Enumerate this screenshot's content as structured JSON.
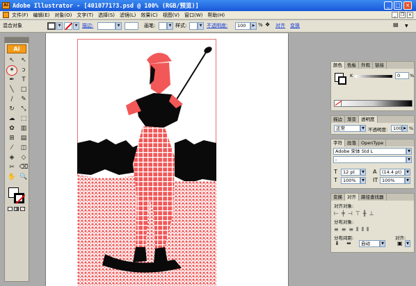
{
  "title_bar": {
    "title": "Adobe Illustrator - [4010771?3.psd @ 100% (RGB/预览)]",
    "app_icon": "Ai",
    "minimize": "_",
    "maximize": "□",
    "close": "×"
  },
  "menu_bar": {
    "items": [
      "文件(F)",
      "编辑(E)",
      "对象(O)",
      "文字(T)",
      "选择(S)",
      "滤镜(L)",
      "效果(C)",
      "视图(V)",
      "窗口(W)",
      "帮助(H)"
    ]
  },
  "control_bar": {
    "selection_label": "混合对象",
    "stroke_label": "描边:",
    "brush_label": "画笔:",
    "style_label": "样式:",
    "opacity_label": "不透明度:",
    "opacity_value": "100",
    "opacity_unit": "%",
    "align_link": "对齐",
    "transform_link": "变换"
  },
  "tool_panel": {
    "logo": "Ai",
    "tools": [
      {
        "name": "selection-tool-icon",
        "glyph": "↖"
      },
      {
        "name": "direct-selection-tool-icon",
        "glyph": "↖"
      },
      {
        "name": "magic-wand-tool-icon",
        "glyph": "✶",
        "highlighted": true
      },
      {
        "name": "lasso-tool-icon",
        "glyph": "ↄ"
      },
      {
        "name": "pen-tool-icon",
        "glyph": "✒"
      },
      {
        "name": "type-tool-icon",
        "glyph": "T"
      },
      {
        "name": "line-tool-icon",
        "glyph": "╲"
      },
      {
        "name": "rectangle-tool-icon",
        "glyph": "□"
      },
      {
        "name": "paintbrush-tool-icon",
        "glyph": "∕"
      },
      {
        "name": "pencil-tool-icon",
        "glyph": "✎"
      },
      {
        "name": "rotate-tool-icon",
        "glyph": "↻"
      },
      {
        "name": "scale-tool-icon",
        "glyph": "⤡"
      },
      {
        "name": "warp-tool-icon",
        "glyph": "☁"
      },
      {
        "name": "free-transform-tool-icon",
        "glyph": "⬚"
      },
      {
        "name": "symbol-sprayer-tool-icon",
        "glyph": "✿"
      },
      {
        "name": "column-graph-tool-icon",
        "glyph": "▥"
      },
      {
        "name": "mesh-tool-icon",
        "glyph": "⊞"
      },
      {
        "name": "gradient-tool-icon",
        "glyph": "▤"
      },
      {
        "name": "eyedropper-tool-icon",
        "glyph": "⁄"
      },
      {
        "name": "blend-tool-icon",
        "glyph": "◫"
      },
      {
        "name": "live-paint-bucket-tool-icon",
        "glyph": "◈"
      },
      {
        "name": "live-paint-selection-tool-icon",
        "glyph": "◇"
      },
      {
        "name": "slice-tool-icon",
        "glyph": "✂"
      },
      {
        "name": "eraser-tool-icon",
        "glyph": "⌫"
      },
      {
        "name": "hand-tool-icon",
        "glyph": "✋"
      },
      {
        "name": "zoom-tool-icon",
        "glyph": "🔍"
      }
    ]
  },
  "color_panel": {
    "tabs": [
      "颜色",
      "色板",
      "外观",
      "链接"
    ],
    "k_label": "K",
    "k_value": "0",
    "k_unit": "%"
  },
  "transparency_panel": {
    "tabs": [
      "描边",
      "渐变",
      "透明度"
    ],
    "mode": "正常",
    "opacity_label": "不透明度:",
    "opacity_value": "100",
    "opacity_unit": "%"
  },
  "character_panel": {
    "tabs": [
      "字符",
      "段落",
      "OpenType"
    ],
    "font": "Adobe 宋体 Std L",
    "style": "-",
    "size": "12 pt",
    "leading": "(14.4 pt)",
    "hscale": "100%",
    "vscale": "100%"
  },
  "align_panel": {
    "tabs": [
      "变换",
      "对齐",
      "路径查找器"
    ],
    "align_objects_label": "对齐对象:",
    "distribute_objects_label": "分布对象:",
    "distribute_spacing_label": "分布间距:",
    "spacing_mode": "自动",
    "align_to_label": "对齐:"
  },
  "colors": {
    "artwork_red": "#f25858",
    "artwork_black": "#0a0a0a",
    "titlebar_blue": "#1857d8"
  }
}
